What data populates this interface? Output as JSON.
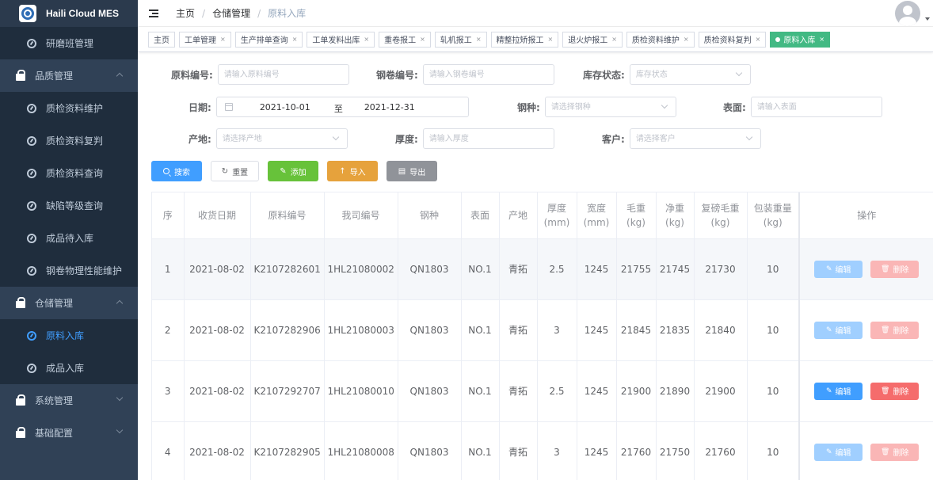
{
  "app": {
    "title": "Haili Cloud MES"
  },
  "sidebar": {
    "items": [
      {
        "label": "研磨班管理",
        "type": "sub",
        "active": false
      },
      {
        "label": "品质管理",
        "type": "group",
        "open": true
      },
      {
        "label": "质检资料维护",
        "type": "sub",
        "active": false
      },
      {
        "label": "质检资料复判",
        "type": "sub",
        "active": false
      },
      {
        "label": "质检资料查询",
        "type": "sub",
        "active": false
      },
      {
        "label": "缺陷等级查询",
        "type": "sub",
        "active": false
      },
      {
        "label": "成品待入库",
        "type": "sub",
        "active": false
      },
      {
        "label": "钢卷物理性能维护",
        "type": "sub",
        "active": false
      },
      {
        "label": "仓储管理",
        "type": "group",
        "open": true
      },
      {
        "label": "原料入库",
        "type": "sub",
        "active": true
      },
      {
        "label": "成品入库",
        "type": "sub",
        "active": false
      },
      {
        "label": "系统管理",
        "type": "group",
        "open": false
      },
      {
        "label": "基础配置",
        "type": "group",
        "open": false
      }
    ]
  },
  "breadcrumb": [
    "主页",
    "仓储管理",
    "原料入库"
  ],
  "tags": [
    {
      "label": "主页",
      "closable": false,
      "active": false
    },
    {
      "label": "工单管理",
      "closable": true,
      "active": false
    },
    {
      "label": "生产排单查询",
      "closable": true,
      "active": false
    },
    {
      "label": "工单发料出库",
      "closable": true,
      "active": false
    },
    {
      "label": "重卷报工",
      "closable": true,
      "active": false
    },
    {
      "label": "轧机报工",
      "closable": true,
      "active": false
    },
    {
      "label": "精整拉矫报工",
      "closable": true,
      "active": false
    },
    {
      "label": "退火炉报工",
      "closable": true,
      "active": false
    },
    {
      "label": "质检资料维护",
      "closable": true,
      "active": false
    },
    {
      "label": "质检资料复判",
      "closable": true,
      "active": false
    },
    {
      "label": "原料入库",
      "closable": true,
      "active": true
    }
  ],
  "form": {
    "material_no": {
      "label": "原料编号:",
      "placeholder": "请输入原料编号"
    },
    "coil_no": {
      "label": "钢卷编号:",
      "placeholder": "请输入钢卷编号"
    },
    "stock_status": {
      "label": "库存状态:",
      "placeholder": "库存状态"
    },
    "date": {
      "label": "日期:",
      "start": "2021-10-01",
      "sep": "至",
      "end": "2021-12-31"
    },
    "steel_type": {
      "label": "钢种:",
      "placeholder": "请选择钢种"
    },
    "surface": {
      "label": "表面:",
      "placeholder": "请输入表面"
    },
    "origin": {
      "label": "产地:",
      "placeholder": "请选择产地"
    },
    "thickness": {
      "label": "厚度:",
      "placeholder": "请输入厚度"
    },
    "customer": {
      "label": "客户:",
      "placeholder": "请选择客户"
    }
  },
  "buttons": {
    "search": "搜索",
    "reset": "重置",
    "add": "添加",
    "import": "导入",
    "export": "导出"
  },
  "table": {
    "headers": [
      [
        "序"
      ],
      [
        "收货日期"
      ],
      [
        "原料编号"
      ],
      [
        "我司编号"
      ],
      [
        "钢种"
      ],
      [
        "表面"
      ],
      [
        "产地"
      ],
      [
        "厚度",
        "(mm)"
      ],
      [
        "宽度",
        "(mm)"
      ],
      [
        "毛重",
        "(kg)"
      ],
      [
        "净重",
        "(kg)"
      ],
      [
        "复磅毛重",
        "(kg)"
      ],
      [
        "包装重量",
        "(kg)"
      ],
      [
        "操作"
      ]
    ],
    "rows": [
      {
        "cells": [
          "1",
          "2021-08-02",
          "K2107282601",
          "1HL21080002",
          "QN1803",
          "NO.1",
          "青拓",
          "2.5",
          "1245",
          "21755",
          "21745",
          "21730",
          "10"
        ],
        "disabled": true,
        "hover": true
      },
      {
        "cells": [
          "2",
          "2021-08-02",
          "K2107282906",
          "1HL21080003",
          "QN1803",
          "NO.1",
          "青拓",
          "3",
          "1245",
          "21845",
          "21835",
          "21840",
          "10"
        ],
        "disabled": true,
        "hover": false
      },
      {
        "cells": [
          "3",
          "2021-08-02",
          "K2107292707",
          "1HL21080010",
          "QN1803",
          "NO.1",
          "青拓",
          "2.5",
          "1245",
          "21900",
          "21890",
          "21900",
          "10"
        ],
        "disabled": false,
        "hover": false
      },
      {
        "cells": [
          "4",
          "2021-08-02",
          "K2107282905",
          "1HL21080008",
          "QN1803",
          "NO.1",
          "青拓",
          "3",
          "1245",
          "21760",
          "21750",
          "21760",
          "10"
        ],
        "disabled": true,
        "hover": false
      }
    ],
    "edit_label": "编辑",
    "delete_label": "删除"
  }
}
